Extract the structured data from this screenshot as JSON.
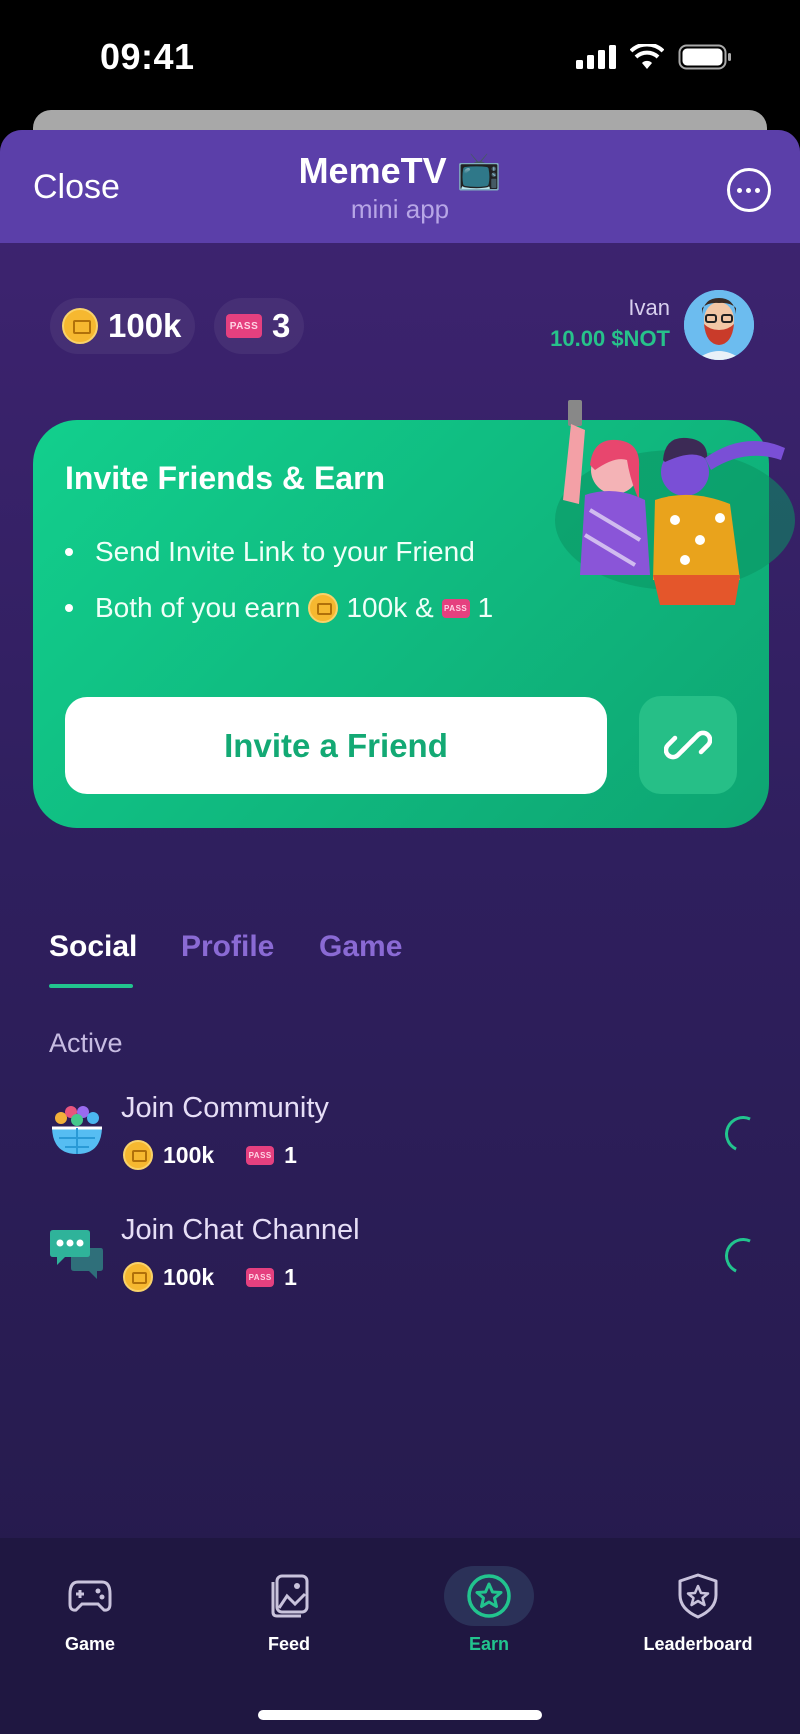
{
  "status_bar": {
    "time": "09:41"
  },
  "header": {
    "close_label": "Close",
    "title": "MemeTV 📺",
    "subtitle": "mini app"
  },
  "balances": {
    "coins": "100k",
    "passes": "3",
    "pass_badge": "PASS"
  },
  "user": {
    "name": "Ivan",
    "balance": "10.00 $NOT"
  },
  "invite_card": {
    "title": "Invite Friends & Earn",
    "bullet_1": "Send Invite Link to your Friend",
    "bullet_2_prefix": "Both of you earn",
    "bullet_2_coins": "100k &",
    "bullet_2_passes": "1",
    "button_label": "Invite a Friend"
  },
  "tabs": [
    {
      "label": "Social",
      "active": true
    },
    {
      "label": "Profile",
      "active": false
    },
    {
      "label": "Game",
      "active": false
    }
  ],
  "section_label": "Active",
  "tasks": [
    {
      "title": "Join Community",
      "coins": "100k",
      "passes": "1",
      "icon": "community-icon"
    },
    {
      "title": "Join Chat Channel",
      "coins": "100k",
      "passes": "1",
      "icon": "chat-icon"
    }
  ],
  "bottom_nav": [
    {
      "label": "Game",
      "icon": "gamepad-icon",
      "active": false
    },
    {
      "label": "Feed",
      "icon": "image-icon",
      "active": false
    },
    {
      "label": "Earn",
      "icon": "star-coin-icon",
      "active": true
    },
    {
      "label": "Leaderboard",
      "icon": "shield-star-icon",
      "active": false
    }
  ],
  "colors": {
    "accent": "#22c48e",
    "header": "#5b3fa9",
    "card": "#12cf8d",
    "pass": "#e5407f",
    "coin": "#f6b830"
  }
}
